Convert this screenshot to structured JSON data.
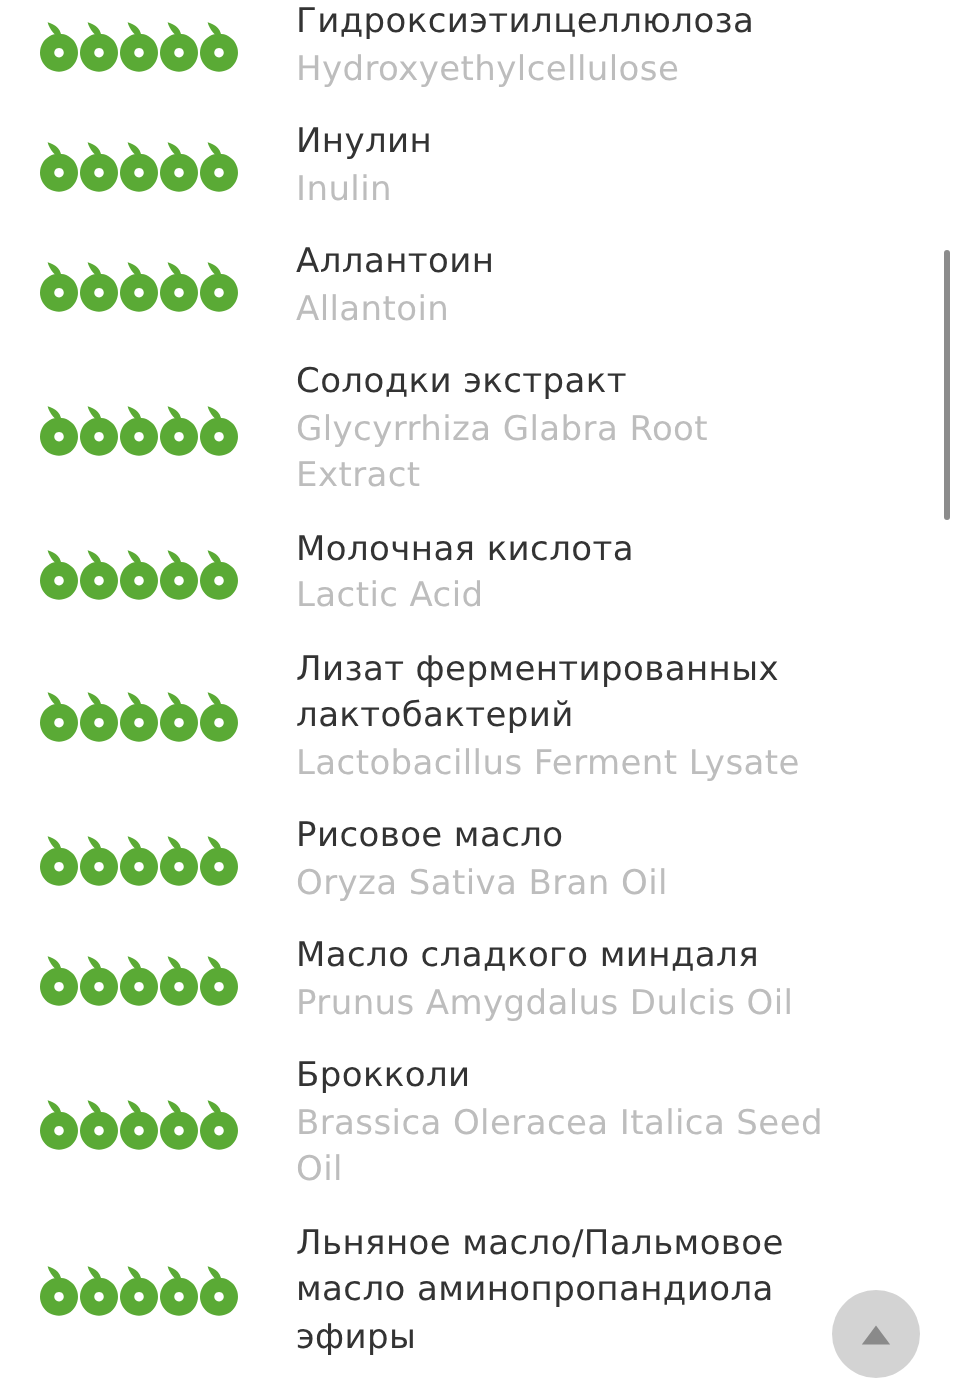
{
  "ingredients": [
    {
      "name": "Гидроксиэтилцеллюлоза",
      "latin": "Hydroxyethylcellulose",
      "stars": 5
    },
    {
      "name": "Инулин",
      "latin": "Inulin",
      "stars": 5
    },
    {
      "name": "Аллантоин",
      "latin": "Allantoin",
      "stars": 5
    },
    {
      "name": "Солодки экстракт",
      "latin": "Glycyrrhiza Glabra Root\nExtract",
      "stars": 5
    },
    {
      "name": "Молочная кислота",
      "latin": "Lactic Acid",
      "stars": 5
    },
    {
      "name": "Лизат ферментированных\nлактобактерий",
      "latin": "Lactobacillus Ferment Lysate",
      "stars": 5
    },
    {
      "name": "Рисовое масло",
      "latin": "Oryza Sativa Bran Oil",
      "stars": 5
    },
    {
      "name": "Масло сладкого миндаля",
      "latin": "Prunus Amygdalus Dulcis Oil",
      "stars": 5
    },
    {
      "name": "Брокколи",
      "latin": "Brassica Oleracea Italica Seed\nOil",
      "stars": 5
    },
    {
      "name": "Льняное масло/Пальмовое\nмасло аминопропандиола\nэфиры",
      "stars": 5
    }
  ]
}
